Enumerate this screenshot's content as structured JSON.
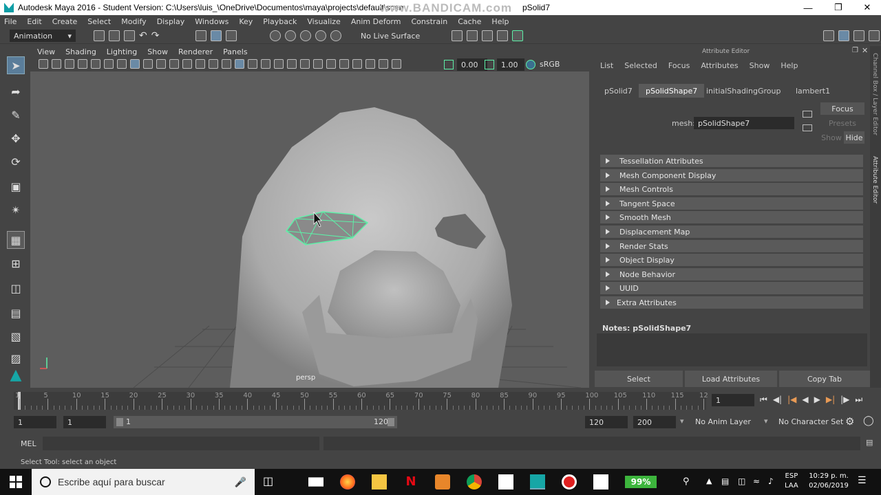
{
  "window": {
    "title": "Autodesk Maya 2016 - Student Version: C:\\Users\\luis_\\OneDrive\\Documentos\\maya\\projects\\default\\scenes\\...",
    "title_suffix": "pSolid7",
    "watermark": "www.BANDICAM.com"
  },
  "menu": [
    "File",
    "Edit",
    "Create",
    "Select",
    "Modify",
    "Display",
    "Windows",
    "Key",
    "Playback",
    "Visualize",
    "Anim Deform",
    "Constrain",
    "Cache",
    "Help"
  ],
  "shelf": {
    "mode": "Animation",
    "live_surface": "No Live Surface"
  },
  "viewport": {
    "menu": [
      "View",
      "Shading",
      "Lighting",
      "Show",
      "Renderer",
      "Panels"
    ],
    "field1": "0.00",
    "field2": "1.00",
    "colorspace": "sRGB gamma",
    "camera_label": "persp"
  },
  "attribute_editor": {
    "header": "Attribute Editor",
    "menu": [
      "List",
      "Selected",
      "Focus",
      "Attributes",
      "Show",
      "Help"
    ],
    "tabs": [
      "pSolid7",
      "pSolidShape7",
      "initialShadingGroup",
      "lambert1"
    ],
    "active_tab": "pSolidShape7",
    "mesh_label": "mesh:",
    "mesh_value": "pSolidShape7",
    "focus_btn": "Focus",
    "presets_btn": "Presets",
    "show_btn": "Show",
    "hide_btn": "Hide",
    "sections": [
      "Tessellation Attributes",
      "Mesh Component Display",
      "Mesh Controls",
      "Tangent Space",
      "Smooth Mesh",
      "Displacement Map",
      "Render Stats",
      "Object Display",
      "Node Behavior",
      "UUID",
      "Extra Attributes"
    ],
    "notes_label": "Notes:  pSolidShape7",
    "buttons": {
      "select": "Select",
      "load": "Load Attributes",
      "copy": "Copy Tab"
    },
    "side_label_1": "Channel Box / Layer Editor",
    "side_label_2": "Attribute Editor"
  },
  "timeline": {
    "ticks": [
      "1",
      "5",
      "10",
      "15",
      "20",
      "25",
      "30",
      "35",
      "40",
      "45",
      "50",
      "55",
      "60",
      "65",
      "70",
      "75",
      "80",
      "85",
      "90",
      "95",
      "100",
      "105",
      "110",
      "115",
      "12"
    ],
    "current_frame": "1"
  },
  "range": {
    "start": "1",
    "inner_start": "1",
    "slider_start": "1",
    "slider_end": "120",
    "end": "120",
    "max": "200",
    "anim_layer": "No Anim Layer",
    "char_set": "No Character Set"
  },
  "command": {
    "mode": "MEL"
  },
  "helpline": "Select Tool: select an object",
  "taskbar": {
    "search_placeholder": "Escribe aquí para buscar",
    "battery": "99%",
    "lang": "ESP",
    "lang2": "LAA",
    "time": "10:29 p. m.",
    "date": "02/06/2019"
  },
  "colors": {
    "accent": "#5ef0a8",
    "selection": "#5ef0a8",
    "battery": "#3db53d"
  }
}
